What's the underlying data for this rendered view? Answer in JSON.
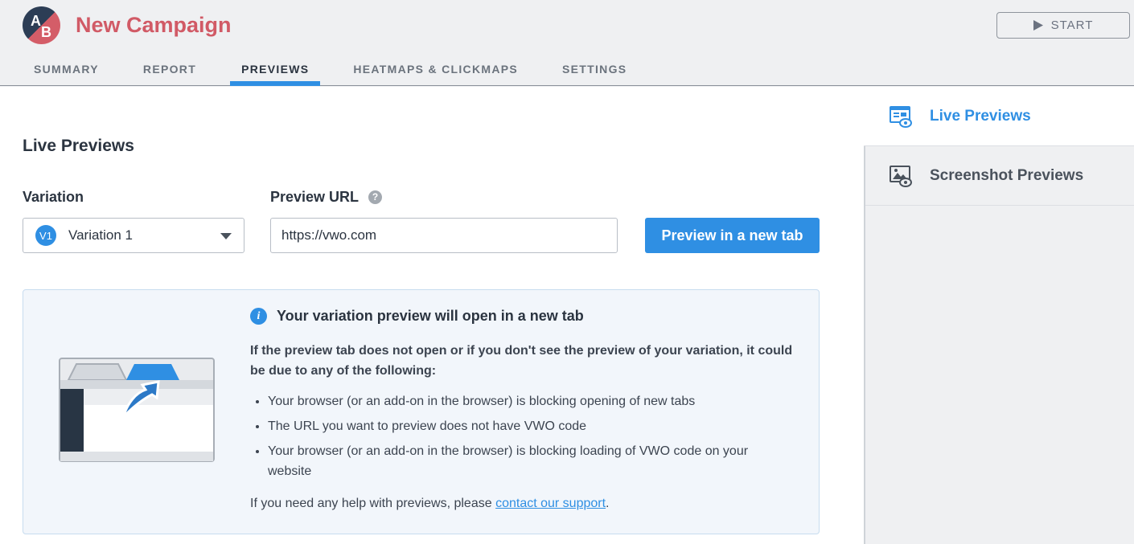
{
  "header": {
    "logo_letters": [
      "A",
      "B"
    ],
    "title": "New Campaign",
    "start_label": "START"
  },
  "tabs": [
    {
      "label": "SUMMARY"
    },
    {
      "label": "REPORT"
    },
    {
      "label": "PREVIEWS",
      "active": true
    },
    {
      "label": "HEATMAPS & CLICKMAPS"
    },
    {
      "label": "SETTINGS"
    }
  ],
  "sidebar": {
    "items": [
      {
        "label": "Live Previews",
        "icon": "live-preview-icon",
        "active": true
      },
      {
        "label": "Screenshot Previews",
        "icon": "screenshot-preview-icon"
      }
    ]
  },
  "main": {
    "heading": "Live Previews",
    "variation_label": "Variation",
    "variation": {
      "badge": "V1",
      "value": "Variation 1"
    },
    "url_label": "Preview URL",
    "url_value": "https://vwo.com",
    "preview_button": "Preview in a new tab",
    "info": {
      "title": "Your variation preview will open in a new tab",
      "description": "If the preview tab does not open or if you don't see the preview of your variation, it could be due to any of the following:",
      "reasons": [
        "Your browser (or an add-on in the browser) is blocking opening of new tabs",
        "The URL you want to preview does not have VWO code",
        "Your browser (or an add-on in the browser) is blocking loading of VWO code on your website"
      ],
      "footer_prefix": "If you need any help with previews, please ",
      "footer_link": "contact our support",
      "footer_suffix": "."
    }
  },
  "colors": {
    "accent": "#2f8fe3",
    "brand": "#d15a66"
  }
}
